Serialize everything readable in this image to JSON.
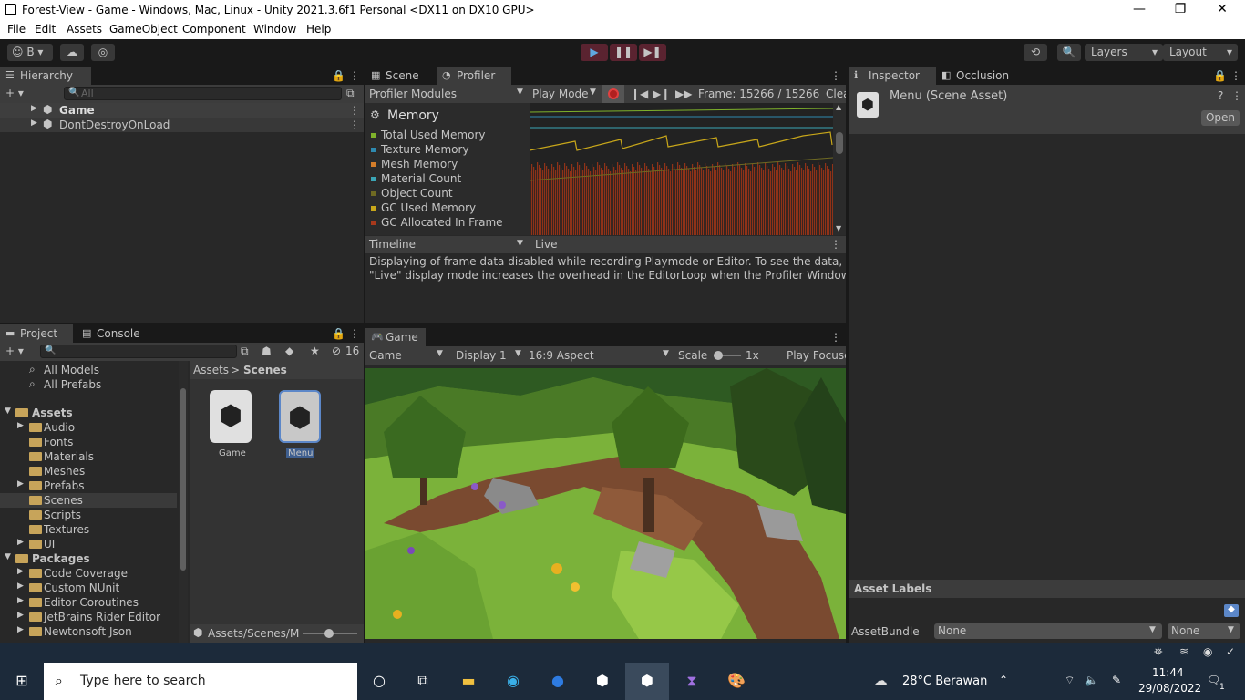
{
  "window": {
    "title": "Forest-View - Game - Windows, Mac, Linux - Unity 2021.3.6f1 Personal <DX11 on DX10 GPU>",
    "minimize": "—",
    "maximize": "❐",
    "close": "✕"
  },
  "menu": [
    "File",
    "Edit",
    "Assets",
    "GameObject",
    "Component",
    "Window",
    "Help"
  ],
  "toolbar": {
    "account": "B",
    "layers_label": "Layers",
    "layout_label": "Layout"
  },
  "hierarchy": {
    "tab": "Hierarchy",
    "search_placeholder": "All",
    "items": [
      "Game",
      "DontDestroyOnLoad"
    ]
  },
  "profiler": {
    "tab_scene": "Scene",
    "tab_profiler": "Profiler",
    "modules_label": "Profiler Modules",
    "play_mode": "Play Mode",
    "frame": "Frame: 15266 / 15266",
    "clear": "Clea",
    "section": "Memory",
    "legend": [
      {
        "label": "Total Used Memory",
        "color": "#7fb22b"
      },
      {
        "label": "Texture Memory",
        "color": "#2e8ab0"
      },
      {
        "label": "Mesh Memory",
        "color": "#d47d2a"
      },
      {
        "label": "Material Count",
        "color": "#3ba6b6"
      },
      {
        "label": "Object Count",
        "color": "#6f6a22"
      },
      {
        "label": "GC Used Memory",
        "color": "#c8a71a"
      },
      {
        "label": "GC Allocated In Frame",
        "color": "#a8391c"
      }
    ],
    "timeline": "Timeline",
    "live": "Live",
    "message1": "Displaying of frame data disabled while recording Playmode or Editor. To see the data, pause",
    "message2": "\"Live\" display mode increases the overhead in the EditorLoop when the Profiler Window is re|"
  },
  "inspector": {
    "tab": "Inspector",
    "tab2": "Occlusion",
    "asset_title": "Menu (Scene Asset)",
    "open_button": "Open",
    "asset_labels": "Asset Labels",
    "assetbundle_label": "AssetBundle",
    "assetbundle_value": "None",
    "variant_value": "None"
  },
  "project": {
    "tab": "Project",
    "tab2": "Console",
    "hidden_count": "16",
    "favorites": [
      "All Models",
      "All Prefabs"
    ],
    "assets_root": "Assets",
    "assets_children": [
      "Audio",
      "Fonts",
      "Materials",
      "Meshes",
      "Prefabs",
      "Scenes",
      "Scripts",
      "Textures",
      "UI"
    ],
    "packages_root": "Packages",
    "packages_children": [
      "Code Coverage",
      "Custom NUnit",
      "Editor Coroutines",
      "JetBrains Rider Editor",
      "Newtonsoft Json"
    ],
    "breadcrumb_root": "Assets",
    "breadcrumb_sep": ">",
    "breadcrumb_current": "Scenes",
    "files": [
      "Game",
      "Menu"
    ],
    "footer_path": "Assets/Scenes/M"
  },
  "game": {
    "tab": "Game",
    "mode": "Game",
    "display": "Display 1",
    "aspect": "16:9 Aspect",
    "scale_label": "Scale",
    "scale_value": "1x",
    "play_focused": "Play Focuse"
  },
  "taskbar": {
    "search_placeholder": "Type here to search",
    "weather": "28°C  Berawan",
    "time": "11:44",
    "date": "29/08/2022",
    "notif_count": "1"
  }
}
